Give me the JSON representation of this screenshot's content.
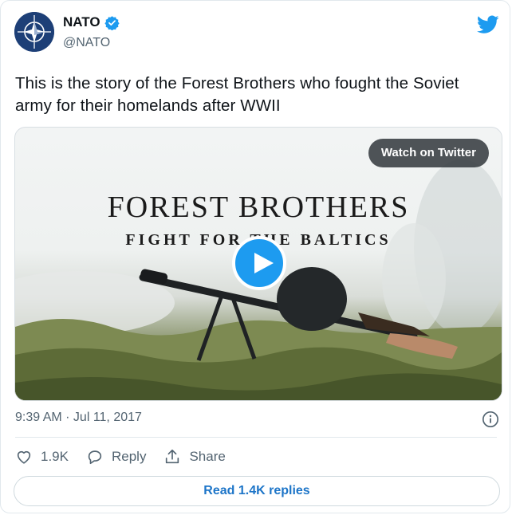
{
  "author": {
    "name": "NATO",
    "handle": "@NATO",
    "avatar_icon": "nato-compass-star-icon",
    "verified_icon": "verified-badge-icon"
  },
  "platform_icon": "twitter-bird-icon",
  "tweet": {
    "text": "This is the story of the Forest Brothers who fought the Soviet army for their homelands after WWII"
  },
  "media": {
    "watch_button": "Watch on Twitter",
    "title_line1": "FOREST  BROTHERS",
    "title_line2": "FIGHT FOR THE BALTICS",
    "play_icon": "play-icon"
  },
  "meta": {
    "timestamp": "9:39 AM · Jul 11, 2017",
    "info_icon": "info-icon"
  },
  "actions": {
    "like_count": "1.9K",
    "reply_label": "Reply",
    "share_label": "Share"
  },
  "replies_button": "Read 1.4K replies",
  "colors": {
    "accent": "#1d9bf0",
    "link": "#1d75c8",
    "muted": "#536471",
    "avatar_bg": "#1d3f77"
  }
}
